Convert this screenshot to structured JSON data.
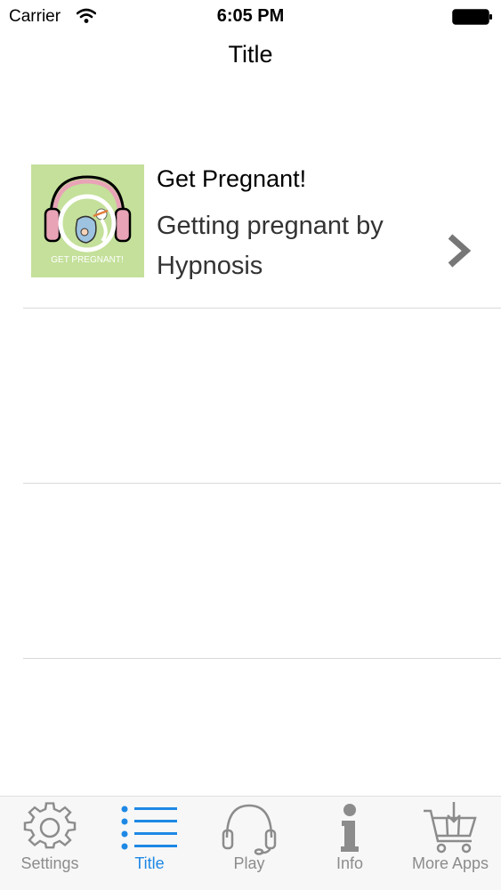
{
  "status_bar": {
    "carrier": "Carrier",
    "time": "6:05 PM"
  },
  "nav": {
    "title": "Title"
  },
  "list": {
    "items": [
      {
        "title": "Get Pregnant!",
        "subtitle": "Getting pregnant by Hypnosis",
        "thumbnail_caption": "GET PREGNANT!"
      }
    ]
  },
  "tabs": [
    {
      "label": "Settings",
      "icon": "gear-icon",
      "active": false
    },
    {
      "label": "Title",
      "icon": "list-icon",
      "active": true
    },
    {
      "label": "Play",
      "icon": "headphones-icon",
      "active": false
    },
    {
      "label": "Info",
      "icon": "info-icon",
      "active": false
    },
    {
      "label": "More Apps",
      "icon": "cart-icon",
      "active": false
    }
  ],
  "colors": {
    "accent": "#1e88e5",
    "tab_inactive": "#8c8c8c",
    "thumbnail_bg": "#c4e09a",
    "headphone_pink": "#e8a4b6"
  }
}
